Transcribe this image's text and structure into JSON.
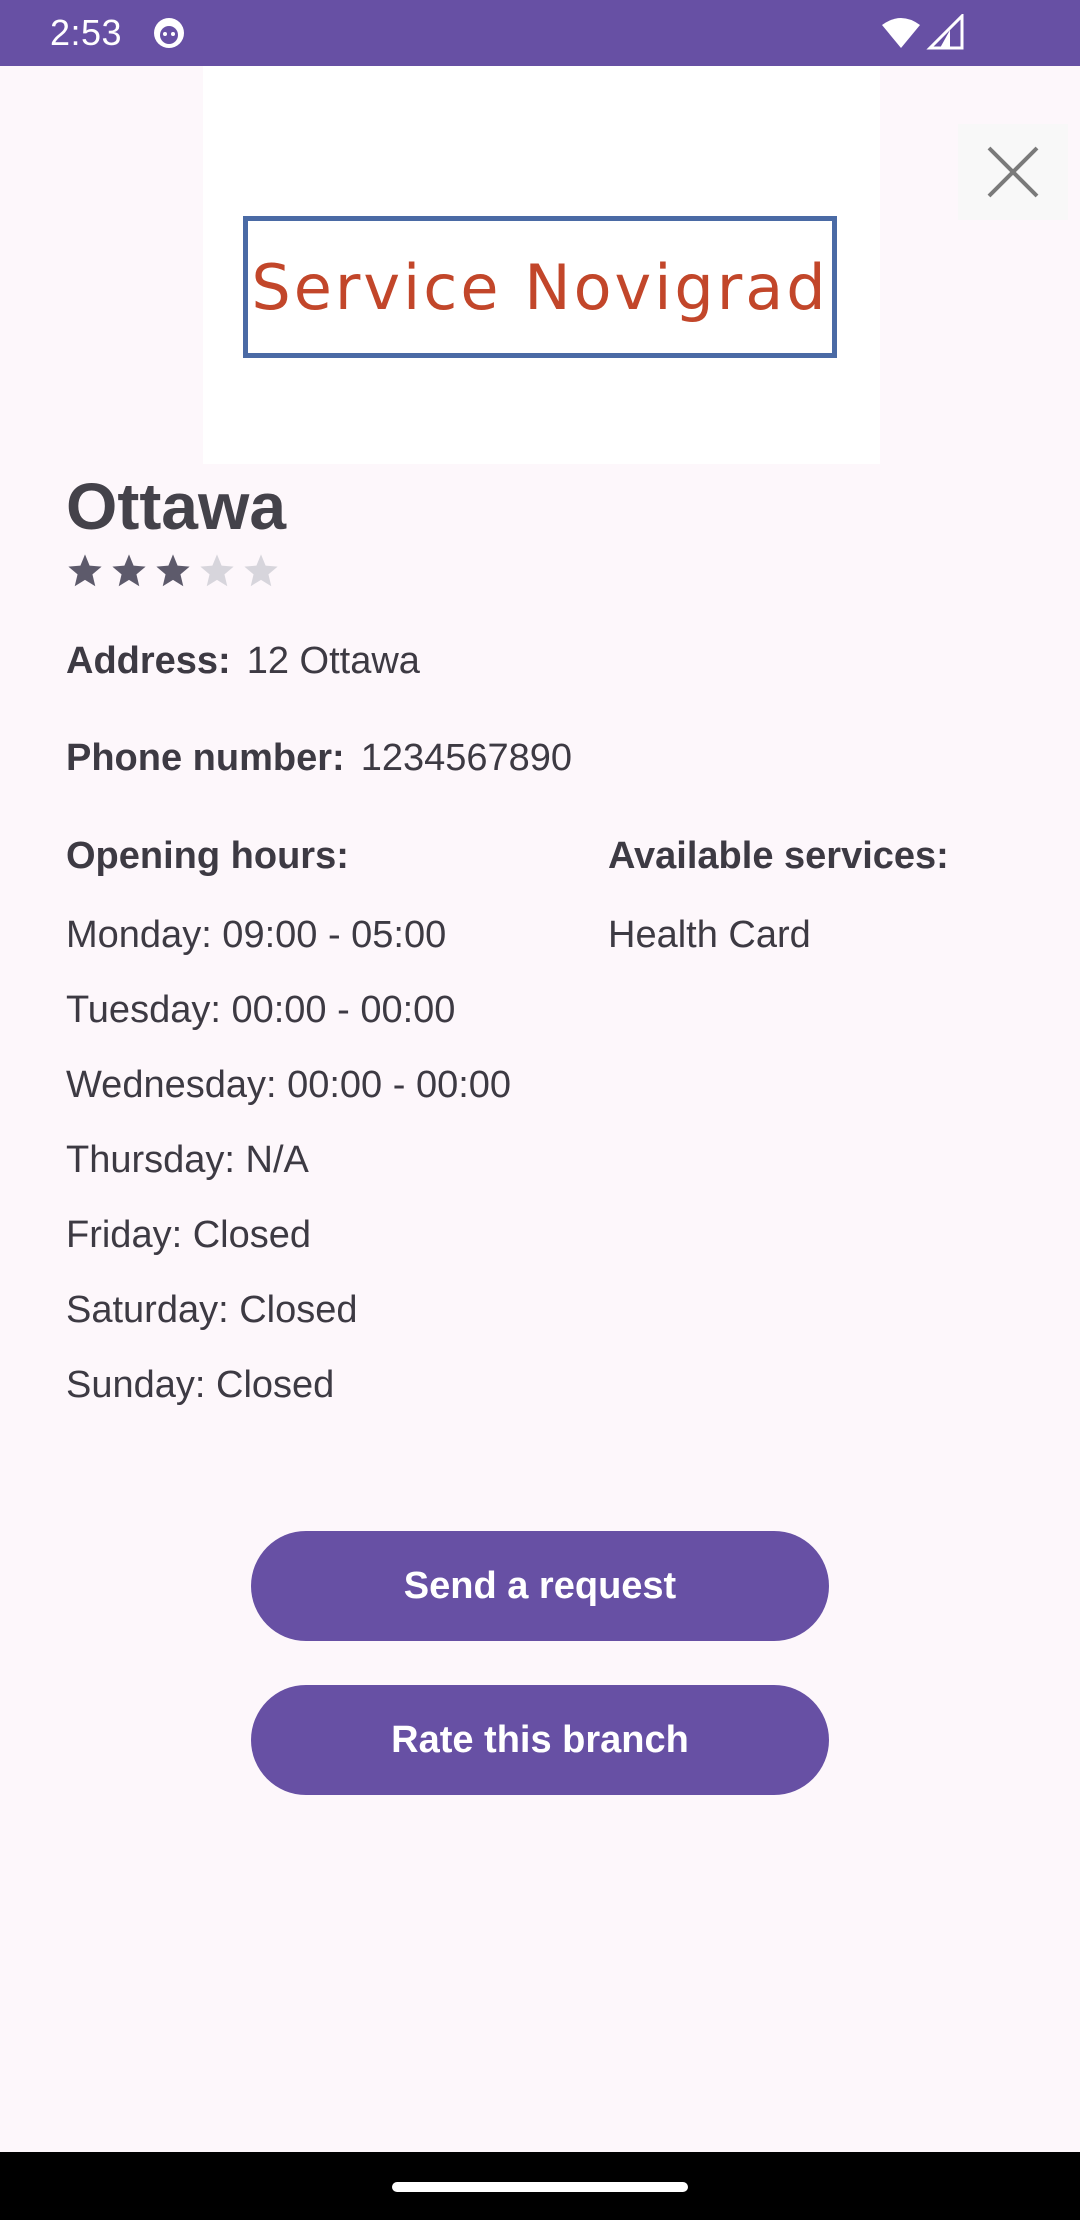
{
  "status_bar": {
    "time": "2:53"
  },
  "logo": {
    "text": "Service Novigrad"
  },
  "branch": {
    "name": "Ottawa",
    "rating": {
      "value": 3,
      "max": 5
    },
    "address_label": "Address:",
    "address": "12 Ottawa",
    "phone_label": "Phone number:",
    "phone": "1234567890"
  },
  "opening_hours": {
    "heading": "Opening hours:",
    "days": [
      "Monday: 09:00 - 05:00",
      "Tuesday: 00:00 - 00:00",
      "Wednesday: 00:00 - 00:00",
      "Thursday: N/A",
      "Friday: Closed",
      "Saturday: Closed",
      "Sunday: Closed"
    ]
  },
  "services": {
    "heading": "Available services:",
    "items": [
      "Health Card"
    ]
  },
  "actions": {
    "send_request": "Send a request",
    "rate_branch": "Rate this branch"
  },
  "colors": {
    "primary": "#6750a4",
    "background": "#fdf7fb",
    "logo_text": "#c2462a",
    "logo_border": "#4a6aa5",
    "star_filled": "#5d5a6b",
    "star_empty": "#d7d5dc"
  }
}
